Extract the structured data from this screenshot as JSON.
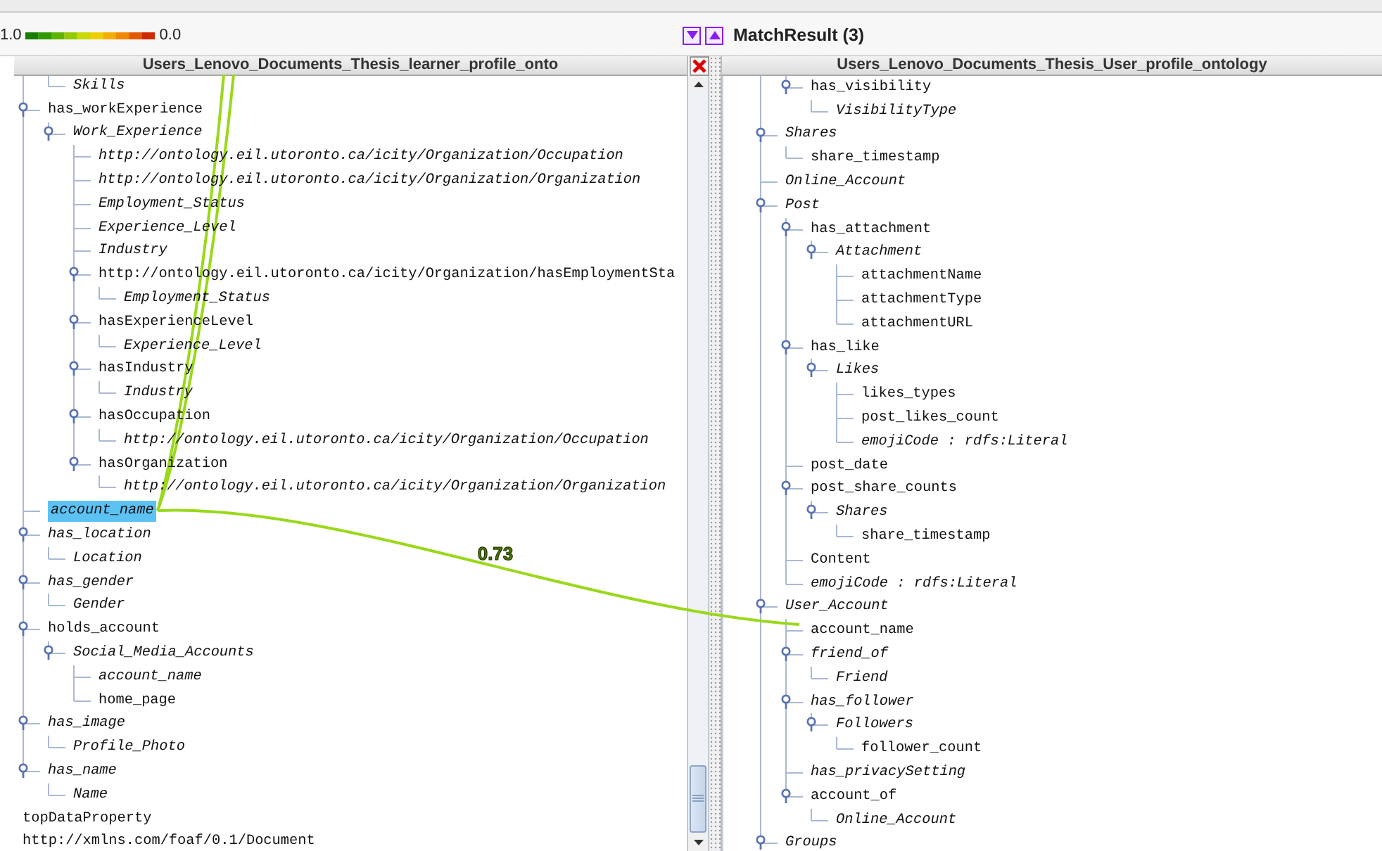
{
  "legend": {
    "high": "1.0",
    "low": "0.0"
  },
  "match_panel": {
    "title": "MatchResult (3)"
  },
  "left_pane": {
    "title": "Users_Lenovo_Documents_Thesis_learner_profile_onto",
    "nodes": [
      {
        "children": [
          {
            "children": [
              {
                "label": "Skills",
                "italic": true,
                "selected": false
              }
            ]
          },
          {
            "label": "has_workExperience",
            "italic": false,
            "selected": false,
            "expanded": true,
            "children": [
              {
                "label": "Work_Experience",
                "italic": true,
                "selected": false,
                "expanded": true,
                "children": [
                  {
                    "label": "http://ontology.eil.utoronto.ca/icity/Organization/Occupation",
                    "italic": true,
                    "selected": false
                  },
                  {
                    "label": "http://ontology.eil.utoronto.ca/icity/Organization/Organization",
                    "italic": true,
                    "selected": false
                  },
                  {
                    "label": "Employment_Status",
                    "italic": true,
                    "selected": false
                  },
                  {
                    "label": "Experience_Level",
                    "italic": true,
                    "selected": false
                  },
                  {
                    "label": "Industry",
                    "italic": true,
                    "selected": false
                  },
                  {
                    "label": "http://ontology.eil.utoronto.ca/icity/Organization/hasEmploymentSta",
                    "italic": false,
                    "selected": false,
                    "expanded": true,
                    "children": [
                      {
                        "label": "Employment_Status",
                        "italic": true,
                        "selected": false
                      }
                    ]
                  },
                  {
                    "label": "hasExperienceLevel",
                    "italic": false,
                    "selected": false,
                    "expanded": true,
                    "children": [
                      {
                        "label": "Experience_Level",
                        "italic": true,
                        "selected": false
                      }
                    ]
                  },
                  {
                    "label": "hasIndustry",
                    "italic": false,
                    "selected": false,
                    "expanded": true,
                    "children": [
                      {
                        "label": "Industry",
                        "italic": true,
                        "selected": false
                      }
                    ]
                  },
                  {
                    "label": "hasOccupation",
                    "italic": false,
                    "selected": false,
                    "expanded": true,
                    "children": [
                      {
                        "label": "http://ontology.eil.utoronto.ca/icity/Organization/Occupation",
                        "italic": true,
                        "selected": false
                      }
                    ]
                  },
                  {
                    "label": "hasOrganization",
                    "italic": false,
                    "selected": false,
                    "expanded": true,
                    "children": [
                      {
                        "label": "http://ontology.eil.utoronto.ca/icity/Organization/Organization",
                        "italic": true,
                        "selected": false
                      }
                    ]
                  }
                ]
              }
            ]
          },
          {
            "label": "account_name",
            "italic": true,
            "selected": true
          },
          {
            "label": "has_location",
            "italic": true,
            "selected": false,
            "expanded": true,
            "children": [
              {
                "label": "Location",
                "italic": true,
                "selected": false
              }
            ]
          },
          {
            "label": "has_gender",
            "italic": true,
            "selected": false,
            "expanded": true,
            "children": [
              {
                "label": "Gender",
                "italic": true,
                "selected": false
              }
            ]
          },
          {
            "label": "holds_account",
            "italic": false,
            "selected": false,
            "expanded": true,
            "children": [
              {
                "label": "Social_Media_Accounts",
                "italic": true,
                "selected": false,
                "expanded": true,
                "children": [
                  {
                    "label": "account_name",
                    "italic": true,
                    "selected": false
                  },
                  {
                    "label": "home_page",
                    "italic": false,
                    "selected": false
                  }
                ]
              }
            ]
          },
          {
            "label": "has_image",
            "italic": true,
            "selected": false,
            "expanded": true,
            "children": [
              {
                "label": "Profile_Photo",
                "italic": true,
                "selected": false
              }
            ]
          },
          {
            "label": "has_name",
            "italic": true,
            "selected": false,
            "expanded": true,
            "children": [
              {
                "label": "Name",
                "italic": true,
                "selected": false
              }
            ]
          }
        ]
      },
      {
        "label": "topDataProperty",
        "italic": false,
        "selected": false
      },
      {
        "label": "http://xmlns.com/foaf/0.1/Document",
        "italic": false,
        "selected": false
      }
    ]
  },
  "right_pane": {
    "title": "Users_Lenovo_Documents_Thesis_User_profile_ontology",
    "nodes": [
      {
        "children": [
          {
            "children": [
              {
                "label": "has_visibility",
                "italic": false,
                "selected": false,
                "expanded": true,
                "children": [
                  {
                    "label": "VisibilityType",
                    "italic": true,
                    "selected": false
                  }
                ]
              }
            ]
          },
          {
            "label": "Shares",
            "italic": true,
            "selected": false,
            "expanded": true,
            "children": [
              {
                "label": "share_timestamp",
                "italic": false,
                "selected": false
              }
            ]
          },
          {
            "label": "Online_Account",
            "italic": true,
            "selected": false
          },
          {
            "label": "Post",
            "italic": true,
            "selected": false,
            "expanded": true,
            "children": [
              {
                "label": "has_attachment",
                "italic": false,
                "selected": false,
                "expanded": true,
                "children": [
                  {
                    "label": "Attachment",
                    "italic": true,
                    "selected": false,
                    "expanded": true,
                    "children": [
                      {
                        "label": "attachmentName",
                        "italic": false,
                        "selected": false
                      },
                      {
                        "label": "attachmentType",
                        "italic": false,
                        "selected": false
                      },
                      {
                        "label": "attachmentURL",
                        "italic": false,
                        "selected": false
                      }
                    ]
                  }
                ]
              },
              {
                "label": "has_like",
                "italic": false,
                "selected": false,
                "expanded": true,
                "children": [
                  {
                    "label": "Likes",
                    "italic": true,
                    "selected": false,
                    "expanded": true,
                    "children": [
                      {
                        "label": "likes_types",
                        "italic": false,
                        "selected": false
                      },
                      {
                        "label": "post_likes_count",
                        "italic": false,
                        "selected": false
                      },
                      {
                        "label": "emojiCode : rdfs:Literal",
                        "italic": true,
                        "selected": false
                      }
                    ]
                  }
                ]
              },
              {
                "label": "post_date",
                "italic": false,
                "selected": false
              },
              {
                "label": "post_share_counts",
                "italic": false,
                "selected": false,
                "expanded": true,
                "children": [
                  {
                    "label": "Shares",
                    "italic": true,
                    "selected": false,
                    "expanded": true,
                    "children": [
                      {
                        "label": "share_timestamp",
                        "italic": false,
                        "selected": false
                      }
                    ]
                  }
                ]
              },
              {
                "label": "Content",
                "italic": false,
                "selected": false
              },
              {
                "label": "emojiCode : rdfs:Literal",
                "italic": true,
                "selected": false
              }
            ]
          },
          {
            "label": "User_Account",
            "italic": true,
            "selected": false,
            "expanded": true,
            "children": [
              {
                "label": "account_name",
                "italic": false,
                "selected": false
              },
              {
                "label": "friend_of",
                "italic": true,
                "selected": false,
                "expanded": true,
                "children": [
                  {
                    "label": "Friend",
                    "italic": true,
                    "selected": false
                  }
                ]
              },
              {
                "label": "has_follower",
                "italic": true,
                "selected": false,
                "expanded": true,
                "children": [
                  {
                    "label": "Followers",
                    "italic": true,
                    "selected": false,
                    "expanded": true,
                    "children": [
                      {
                        "label": "follower_count",
                        "italic": false,
                        "selected": false
                      }
                    ]
                  }
                ]
              },
              {
                "label": "has_privacySetting",
                "italic": true,
                "selected": false
              },
              {
                "label": "account_of",
                "italic": false,
                "selected": false,
                "expanded": true,
                "children": [
                  {
                    "label": "Online_Account",
                    "italic": true,
                    "selected": false
                  }
                ]
              }
            ]
          },
          {
            "label": "Groups",
            "italic": true,
            "selected": false,
            "expanded": true
          }
        ]
      }
    ]
  },
  "matches": [
    {
      "kind": "shown",
      "score": "0.73"
    },
    {
      "kind": "offscreen"
    },
    {
      "kind": "offscreen"
    }
  ]
}
